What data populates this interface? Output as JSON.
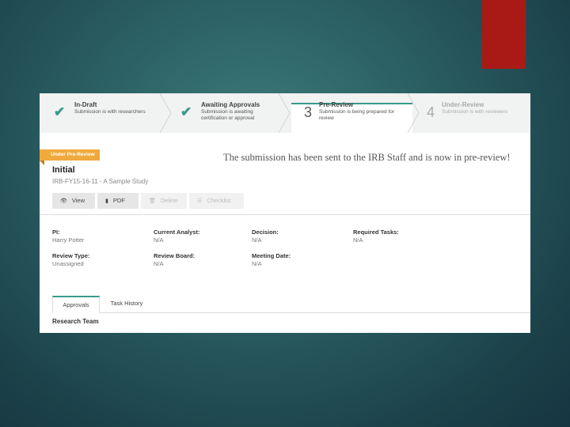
{
  "steps": [
    {
      "title": "In-Draft",
      "desc": "Submission is with researchers",
      "icon": "check-icon"
    },
    {
      "title": "Awaiting Approvals",
      "desc": "Submission is awaiting certification or approval",
      "icon": "check-icon"
    },
    {
      "number": "3",
      "title": "Pre-Review",
      "desc": "Submission is being prepared for review"
    },
    {
      "number": "4",
      "title": "Under-Review",
      "desc": "Submission is with reviewers"
    }
  ],
  "badge": "Under Pre-Review",
  "submission": {
    "title": "Initial",
    "id": "IRB-FY15-16-11 - A Sample Study"
  },
  "message": "The submission has been sent to the IRB Staff and is now in pre-review!",
  "actions": {
    "view": "View",
    "pdf": "PDF",
    "delete": "Delete",
    "checklist": "Checklist"
  },
  "fields": {
    "pi": {
      "label": "PI:",
      "value": "Harry Potter"
    },
    "analyst": {
      "label": "Current Analyst:",
      "value": "N/A"
    },
    "decision": {
      "label": "Decision:",
      "value": "N/A"
    },
    "required_tasks": {
      "label": "Required Tasks:",
      "value": "N/A"
    },
    "review_type": {
      "label": "Review Type:",
      "value": "Unassigned"
    },
    "review_board": {
      "label": "Review Board:",
      "value": "N/A"
    },
    "meeting_date": {
      "label": "Meeting Date:",
      "value": "N/A"
    }
  },
  "tabs": {
    "approvals": "Approvals",
    "task_history": "Task History"
  },
  "section_title": "Research Team",
  "colors": {
    "accent": "#3a9a8c",
    "badge": "#f0a93c",
    "red": "#a91a17"
  }
}
